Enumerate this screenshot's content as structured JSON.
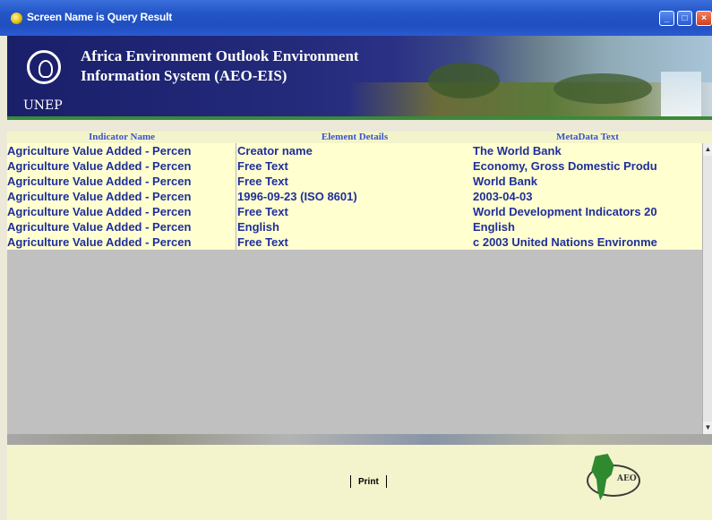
{
  "window": {
    "title": "Screen Name is Query Result"
  },
  "banner": {
    "title": "Africa Environment Outlook   Environment Information System (AEO-EIS)",
    "org_label": "UNEP"
  },
  "grid": {
    "columns": [
      "Indicator Name",
      "Element Details",
      "MetaData Text"
    ],
    "rows": [
      [
        "Agriculture Value Added - Percen",
        "Creator name",
        "The World Bank"
      ],
      [
        "Agriculture Value Added - Percen",
        "Free Text",
        "Economy, Gross Domestic Produ"
      ],
      [
        "Agriculture Value Added - Percen",
        "Free Text",
        "World Bank"
      ],
      [
        "Agriculture Value Added - Percen",
        "1996-09-23 (ISO 8601)",
        "2003-04-03"
      ],
      [
        "Agriculture Value Added - Percen",
        "Free Text",
        "World Development Indicators 20"
      ],
      [
        "Agriculture Value Added - Percen",
        "English",
        "English"
      ],
      [
        "Agriculture Value Added - Percen",
        "Free Text",
        "c 2003 United Nations Environme"
      ]
    ]
  },
  "footer": {
    "print_label": "Print",
    "logo_text": "AEO"
  },
  "icons": {
    "window": "app-icon",
    "minimize": "minimize-icon",
    "maximize": "maximize-icon",
    "close": "close-icon"
  },
  "colors": {
    "titlebar": "#2456c8",
    "grid_header_text": "#3a55c8",
    "cell_text": "#1f2f9a",
    "row_background": "#ffffd0"
  }
}
